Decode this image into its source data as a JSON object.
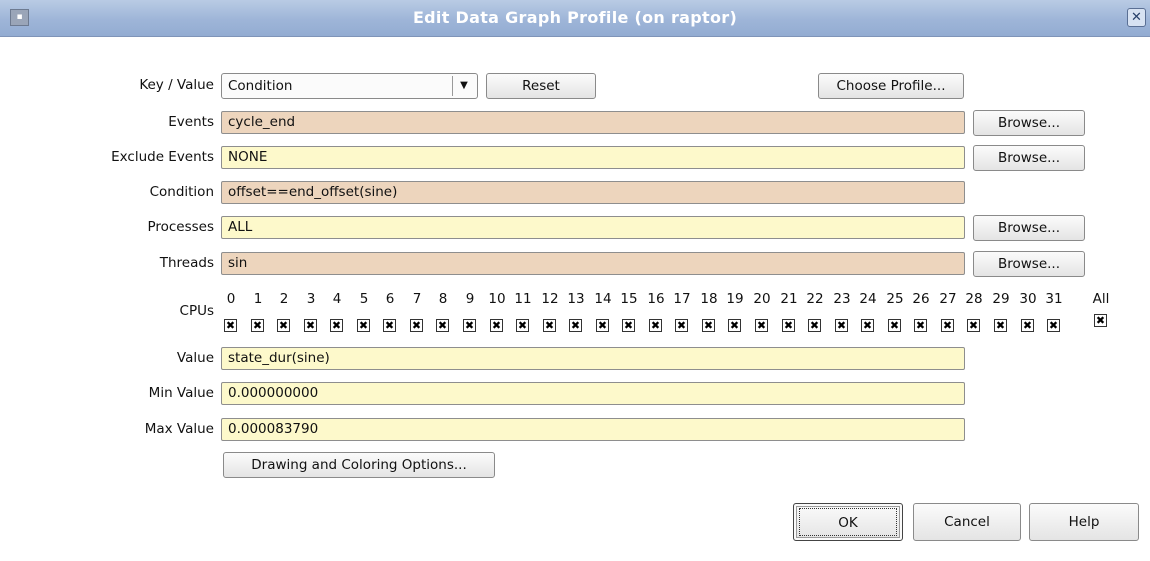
{
  "window": {
    "title": "Edit Data Graph Profile (on raptor)",
    "close_icon": "close-icon",
    "app_icon": "app-icon"
  },
  "key_value": {
    "label": "Key / Value",
    "selected": "Condition",
    "reset_label": "Reset",
    "choose_profile_label": "Choose Profile..."
  },
  "events": {
    "label": "Events",
    "value": "cycle_end",
    "browse_label": "Browse..."
  },
  "exclude_events": {
    "label": "Exclude Events",
    "value": "NONE",
    "browse_label": "Browse..."
  },
  "condition": {
    "label": "Condition",
    "value": "offset==end_offset(sine)"
  },
  "processes": {
    "label": "Processes",
    "value": "ALL",
    "browse_label": "Browse..."
  },
  "threads": {
    "label": "Threads",
    "value": "sin",
    "browse_label": "Browse..."
  },
  "cpus": {
    "label": "CPUs",
    "items": [
      {
        "num": "0",
        "checked": true
      },
      {
        "num": "1",
        "checked": true
      },
      {
        "num": "2",
        "checked": true
      },
      {
        "num": "3",
        "checked": true
      },
      {
        "num": "4",
        "checked": true
      },
      {
        "num": "5",
        "checked": true
      },
      {
        "num": "6",
        "checked": true
      },
      {
        "num": "7",
        "checked": true
      },
      {
        "num": "8",
        "checked": true
      },
      {
        "num": "9",
        "checked": true
      },
      {
        "num": "10",
        "checked": true
      },
      {
        "num": "11",
        "checked": true
      },
      {
        "num": "12",
        "checked": true
      },
      {
        "num": "13",
        "checked": true
      },
      {
        "num": "14",
        "checked": true
      },
      {
        "num": "15",
        "checked": true
      },
      {
        "num": "16",
        "checked": true
      },
      {
        "num": "17",
        "checked": true
      },
      {
        "num": "18",
        "checked": true
      },
      {
        "num": "19",
        "checked": true
      },
      {
        "num": "20",
        "checked": true
      },
      {
        "num": "21",
        "checked": true
      },
      {
        "num": "22",
        "checked": true
      },
      {
        "num": "23",
        "checked": true
      },
      {
        "num": "24",
        "checked": true
      },
      {
        "num": "25",
        "checked": true
      },
      {
        "num": "26",
        "checked": true
      },
      {
        "num": "27",
        "checked": true
      },
      {
        "num": "28",
        "checked": true
      },
      {
        "num": "29",
        "checked": true
      },
      {
        "num": "30",
        "checked": true
      },
      {
        "num": "31",
        "checked": true
      }
    ],
    "all_label": "All",
    "all_checked": true,
    "check_glyph": "✖"
  },
  "value": {
    "label": "Value",
    "value": "state_dur(sine)"
  },
  "min_value": {
    "label": "Min Value",
    "value": "0.000000000"
  },
  "max_value": {
    "label": "Max Value",
    "value": "0.000083790"
  },
  "drawing_options_label": "Drawing and Coloring Options...",
  "footer": {
    "ok_label": "OK",
    "cancel_label": "Cancel",
    "help_label": "Help"
  },
  "colors": {
    "titlebar": "#9eb5d8",
    "field_tan": "#edd5bd",
    "field_yellow": "#fdf9cb"
  }
}
